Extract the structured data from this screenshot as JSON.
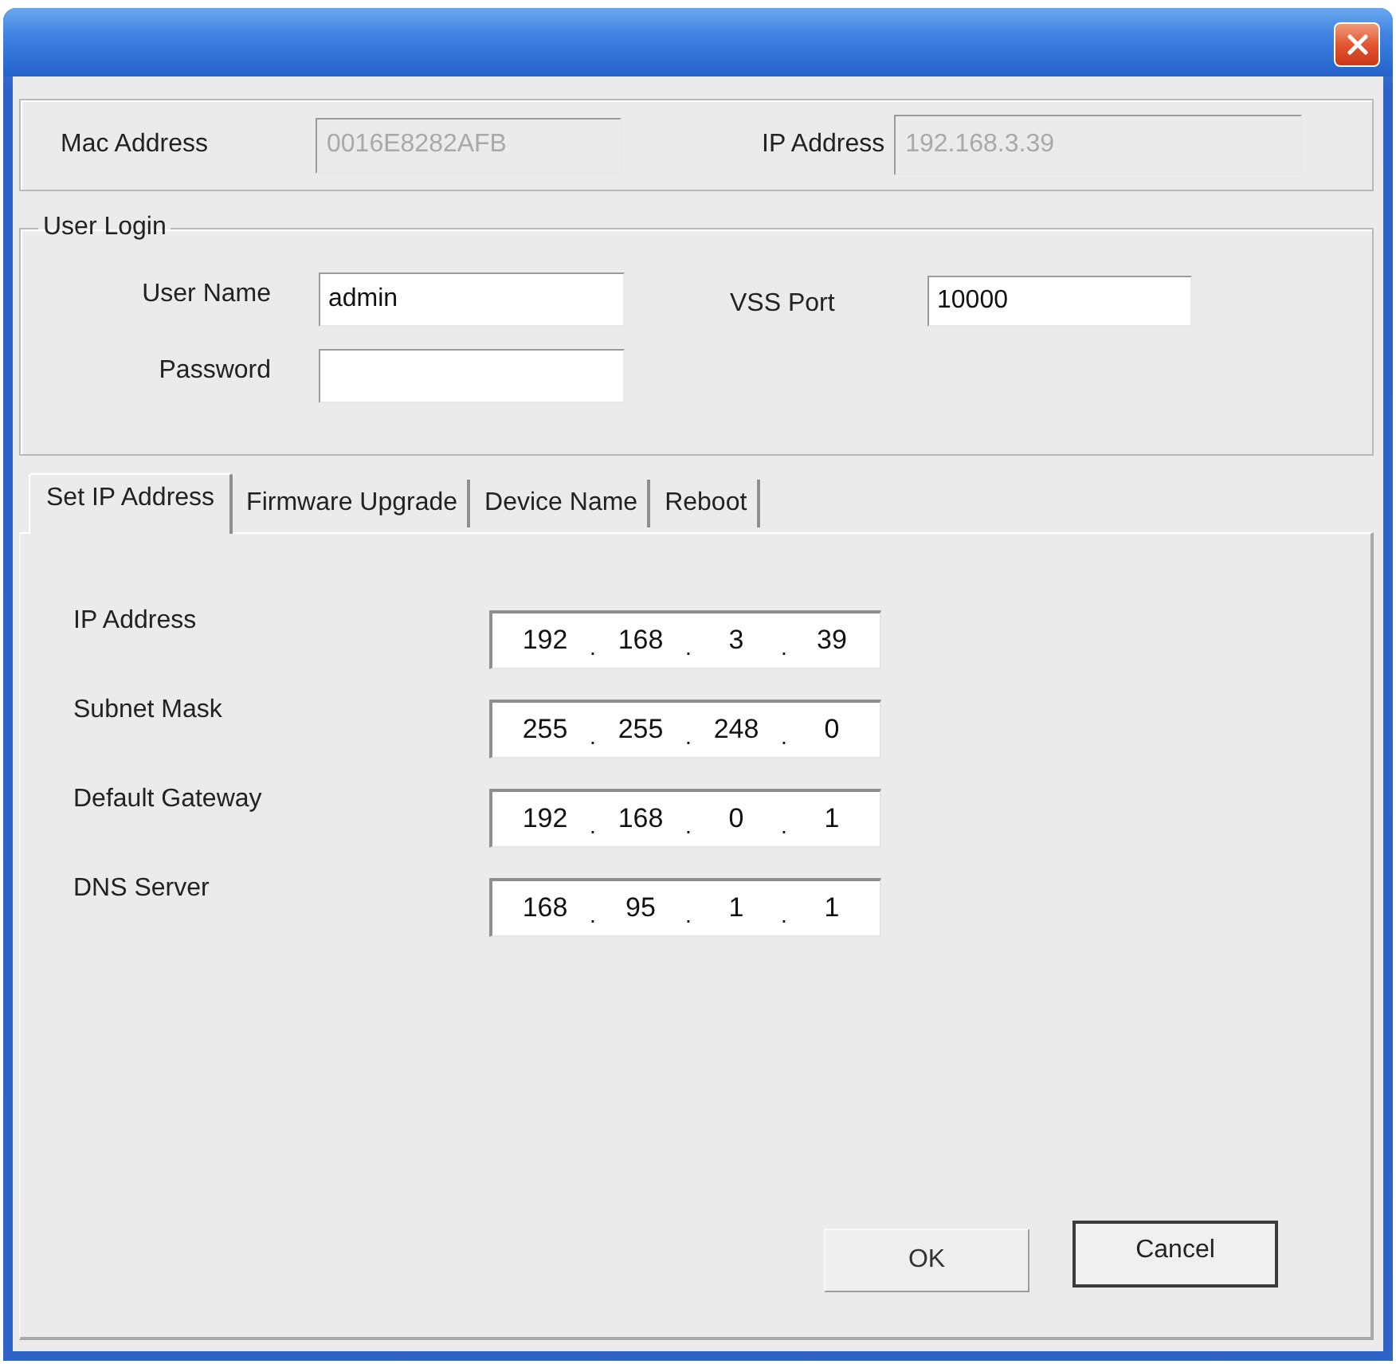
{
  "device_info": [
    {
      "label": "Mac Address",
      "value": "0016E8282AFB",
      "disabled": true
    },
    {
      "label": "IP Address",
      "value": "192.168.3.39",
      "disabled": true
    }
  ],
  "user_login": {
    "title": "User Login",
    "fields": [
      {
        "label": "User Name",
        "value": "admin",
        "disabled": false
      },
      {
        "label": "Password",
        "disabled": false
      }
    ],
    "port": {
      "label": "VSS Port",
      "value": "10000",
      "disabled": false
    }
  },
  "tabs": [
    {
      "label": "Set IP Address",
      "selected": true
    },
    {
      "label": "Firmware Upgrade",
      "selected": false
    },
    {
      "label": "Device Name",
      "selected": false
    },
    {
      "label": "Reboot",
      "selected": false
    }
  ],
  "network": [
    {
      "label": "IP Address",
      "octets": [
        "192",
        "168",
        "3",
        "39"
      ],
      "dots": [
        ".",
        ".",
        "."
      ]
    },
    {
      "label": "Subnet Mask",
      "octets": [
        "255",
        "255",
        "248",
        "0"
      ],
      "dots": [
        ".",
        ".",
        "."
      ]
    },
    {
      "label": "Default Gateway",
      "octets": [
        "192",
        "168",
        "0",
        "1"
      ],
      "dots": [
        ".",
        ".",
        "."
      ]
    },
    {
      "label": "DNS Server",
      "octets": [
        "168",
        "95",
        "1",
        "1"
      ],
      "dots": [
        ".",
        ".",
        "."
      ]
    }
  ],
  "buttons": [
    {
      "label": "OK",
      "default": false
    },
    {
      "label": "Cancel",
      "default": true
    }
  ]
}
